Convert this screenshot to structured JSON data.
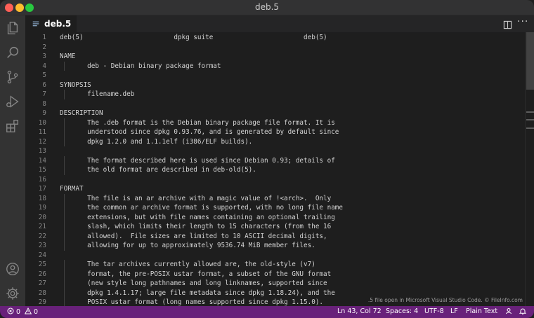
{
  "window": {
    "title": "deb.5"
  },
  "tab": {
    "label": "deb.5"
  },
  "editor": {
    "lines": [
      "deb(5)                       dpkg suite                       deb(5)",
      "",
      "NAME",
      "       deb - Debian binary package format",
      "",
      "SYNOPSIS",
      "       filename.deb",
      "",
      "DESCRIPTION",
      "       The .deb format is the Debian binary package file format. It is",
      "       understood since dpkg 0.93.76, and is generated by default since",
      "       dpkg 1.2.0 and 1.1.1elf (i386/ELF builds).",
      "",
      "       The format described here is used since Debian 0.93; details of",
      "       the old format are described in deb-old(5).",
      "",
      "FORMAT",
      "       The file is an ar archive with a magic value of !<arch>.  Only",
      "       the common ar archive format is supported, with no long file name",
      "       extensions, but with file names containing an optional trailing",
      "       slash, which limits their length to 15 characters (from the 16",
      "       allowed).  File sizes are limited to 10 ASCII decimal digits,",
      "       allowing for up to approximately 9536.74 MiB member files.",
      "",
      "       The tar archives currently allowed are, the old-style (v7)",
      "       format, the pre-POSIX ustar format, a subset of the GNU format",
      "       (new style long pathnames and long linknames, supported since",
      "       dpkg 1.4.1.17; large file metadata since dpkg 1.18.24), and the",
      "       POSIX ustar format (long names supported since dpkg 1.15.0)."
    ]
  },
  "watermark": ".5 file open in Microsoft Visual Studio Code. © FileInfo.com",
  "status": {
    "errors": "0",
    "warnings": "0",
    "position": "Ln 43, Col 72",
    "spaces": "Spaces: 4",
    "encoding": "UTF-8",
    "eol": "LF",
    "language": "Plain Text"
  },
  "icons": {
    "activity": [
      "files-icon",
      "search-icon",
      "source-control-icon",
      "run-debug-icon",
      "extensions-icon",
      "account-icon",
      "settings-gear-icon"
    ],
    "tab": "file-icon",
    "editor_actions": [
      "split-editor-icon",
      "more-actions-icon"
    ],
    "status": [
      "error-icon",
      "warning-icon",
      "feedback-icon",
      "bell-icon"
    ]
  },
  "colors": {
    "statusbar": "#68217a",
    "editor_bg": "#1e1e1e",
    "activitybar": "#333333",
    "text": "#d4d4d4",
    "line_numbers": "#858585"
  }
}
